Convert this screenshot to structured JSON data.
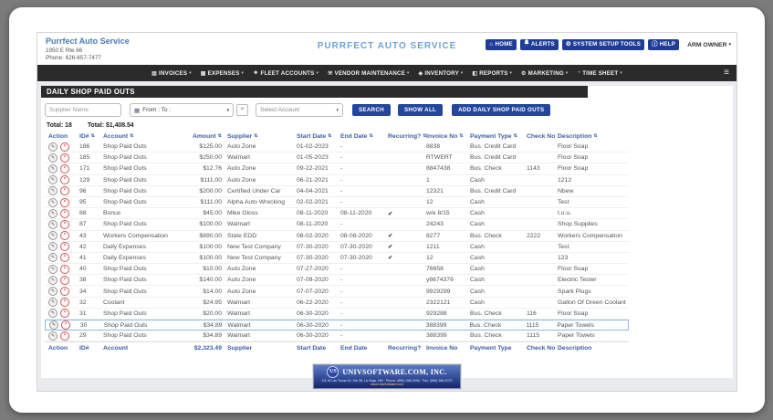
{
  "glyphs": {
    "caret_down": "▾",
    "sort": "⇅",
    "check": "✔",
    "pencil": "✎",
    "close": "×",
    "home": "⌂",
    "gear": "⚙",
    "info": "ⓘ",
    "bell": "🔔",
    "hamburger": "≡",
    "calendar": "▦"
  },
  "colors": {
    "accent_blue": "#24459c",
    "dark_bar": "#2b2b2b",
    "link_blue": "#3b5fa0",
    "title_blue": "#6fa3d9",
    "selected_row_border": "#93b9dd",
    "delete_red": "#c03030"
  },
  "topbar": {
    "company_name": "Purrfect Auto Service",
    "address": "1950 E Rte 66",
    "phone": "Phone: 626-857-7477",
    "app_title": "PURRFECT AUTO SERVICE",
    "buttons": [
      {
        "label": "HOME",
        "icon": "home-icon",
        "glyph": "⌂"
      },
      {
        "label": "ALERTS",
        "icon": "bell-icon",
        "glyph": "♪"
      },
      {
        "label": "SYSTEM SETUP TOOLS",
        "icon": "gear-icon",
        "glyph": "⚙"
      },
      {
        "label": "HELP",
        "icon": "info-icon",
        "glyph": "ⓘ"
      }
    ],
    "user_menu": "ARM OWNER"
  },
  "nav": {
    "items": [
      {
        "label": "INVOICES",
        "icon": "invoices-icon",
        "glyph": "▤"
      },
      {
        "label": "EXPENSES",
        "icon": "expenses-icon",
        "glyph": "▦"
      },
      {
        "label": "FLEET ACCOUNTS",
        "icon": "fleet-accounts-icon",
        "glyph": "☻"
      },
      {
        "label": "VENDOR MAINTENANCE",
        "icon": "vendor-maintenance-icon",
        "glyph": "⚒"
      },
      {
        "label": "INVENTORY",
        "icon": "inventory-icon",
        "glyph": "◆"
      },
      {
        "label": "REPORTS",
        "icon": "reports-icon",
        "glyph": "◧"
      },
      {
        "label": "MARKETING",
        "icon": "marketing-icon",
        "glyph": "⚙"
      },
      {
        "label": "TIME SHEET",
        "icon": "time-sheet-icon",
        "glyph": "◔"
      }
    ]
  },
  "panel": {
    "title": "DAILY SHOP PAID OUTS",
    "filters": {
      "supplier_placeholder": "Supplier Name",
      "date_range_label": "From : To :",
      "clear_label": "×",
      "account_select_value": "Select Account",
      "search_label": "SEARCH",
      "show_all_label": "SHOW ALL",
      "add_label": "ADD DAILY SHOP PAID OUTS"
    },
    "totals": {
      "count_label": "Total: 18",
      "amount_label": "Total: $1,408.54"
    },
    "table": {
      "headers": [
        "Action",
        "ID#",
        "Account",
        "Amount",
        "Supplier",
        "Start Date",
        "End Date",
        "Recurring?",
        "Invoice No",
        "Payment Type",
        "Check No",
        "Description"
      ],
      "rows": [
        {
          "id": "186",
          "account": "Shop Paid Outs",
          "amount": "$125.00",
          "supplier": "Auto Zone",
          "start_date": "01-02-2023",
          "end_date": "-",
          "recurring": false,
          "invoice_no": "8838",
          "payment_type": "Bus. Credit Card",
          "check_no": "",
          "description": "Floor Soap",
          "selected": false
        },
        {
          "id": "185",
          "account": "Shop Paid Outs",
          "amount": "$250.00",
          "supplier": "Walmart",
          "start_date": "01-05-2023",
          "end_date": "-",
          "recurring": false,
          "invoice_no": "RTWERT",
          "payment_type": "Bus. Credit Card",
          "check_no": "",
          "description": "Floor Soap",
          "selected": false
        },
        {
          "id": "171",
          "account": "Shop Paid Outs",
          "amount": "$12.76",
          "supplier": "Auto Zone",
          "start_date": "09-22-2021",
          "end_date": "-",
          "recurring": false,
          "invoice_no": "8847438",
          "payment_type": "Bus. Check",
          "check_no": "1143",
          "description": "Floor Soap",
          "selected": false
        },
        {
          "id": "129",
          "account": "Shop Paid Outs",
          "amount": "$111.00",
          "supplier": "Auto Zone",
          "start_date": "06-21-2021",
          "end_date": "-",
          "recurring": false,
          "invoice_no": "1",
          "payment_type": "Cash",
          "check_no": "",
          "description": "1212",
          "selected": false
        },
        {
          "id": "96",
          "account": "Shop Paid Outs",
          "amount": "$200.00",
          "supplier": "Certified Under Car",
          "start_date": "04-04-2021",
          "end_date": "-",
          "recurring": false,
          "invoice_no": "12321",
          "payment_type": "Bus. Credit Card",
          "check_no": "",
          "description": "Nbew",
          "selected": false
        },
        {
          "id": "95",
          "account": "Shop Paid Outs",
          "amount": "$111.00",
          "supplier": "Alpha Auto Wrecking",
          "start_date": "02-02-2021",
          "end_date": "-",
          "recurring": false,
          "invoice_no": "12",
          "payment_type": "Cash",
          "check_no": "",
          "description": "Test",
          "selected": false
        },
        {
          "id": "88",
          "account": "Bonus",
          "amount": "$45.00",
          "supplier": "Mike Gloss",
          "start_date": "08-11-2020",
          "end_date": "08-11-2020",
          "recurring": true,
          "invoice_no": "w/e 8/15",
          "payment_type": "Cash",
          "check_no": "",
          "description": "I.o.u.",
          "selected": false
        },
        {
          "id": "87",
          "account": "Shop Paid Outs",
          "amount": "$100.00",
          "supplier": "Walmart",
          "start_date": "08-11-2020",
          "end_date": "-",
          "recurring": false,
          "invoice_no": "24243",
          "payment_type": "Cash",
          "check_no": "",
          "description": "Shop Supplies",
          "selected": false
        },
        {
          "id": "43",
          "account": "Workers Compensation",
          "amount": "$890.00",
          "supplier": "State EDD",
          "start_date": "08-02-2020",
          "end_date": "08-08-2020",
          "recurring": true,
          "invoice_no": "8277",
          "payment_type": "Bus. Check",
          "check_no": "2222",
          "description": "Workers Compensation",
          "selected": false
        },
        {
          "id": "42",
          "account": "Daily Expenses",
          "amount": "$100.00",
          "supplier": "New Test Company",
          "start_date": "07-30-2020",
          "end_date": "07-30-2020",
          "recurring": true,
          "invoice_no": "1211",
          "payment_type": "Cash",
          "check_no": "",
          "description": "Test",
          "selected": false
        },
        {
          "id": "41",
          "account": "Daily Expenses",
          "amount": "$100.00",
          "supplier": "New Test Company",
          "start_date": "07-30-2020",
          "end_date": "07-30-2020",
          "recurring": true,
          "invoice_no": "12",
          "payment_type": "Cash",
          "check_no": "",
          "description": "123",
          "selected": false
        },
        {
          "id": "40",
          "account": "Shop Paid Outs",
          "amount": "$10.00",
          "supplier": "Auto Zone",
          "start_date": "07-27-2020",
          "end_date": "-",
          "recurring": false,
          "invoice_no": "76658",
          "payment_type": "Cash",
          "check_no": "",
          "description": "Floor Soap",
          "selected": false
        },
        {
          "id": "38",
          "account": "Shop Paid Outs",
          "amount": "$140.00",
          "supplier": "Auto Zone",
          "start_date": "07-09-2020",
          "end_date": "-",
          "recurring": false,
          "invoice_no": "y6674376",
          "payment_type": "Cash",
          "check_no": "",
          "description": "Electric Tester",
          "selected": false
        },
        {
          "id": "34",
          "account": "Shop Paid Outs",
          "amount": "$14.00",
          "supplier": "Auto Zone",
          "start_date": "07-07-2020",
          "end_date": "-",
          "recurring": false,
          "invoice_no": "9929299",
          "payment_type": "Cash",
          "check_no": "",
          "description": "Spark Plugs",
          "selected": false
        },
        {
          "id": "32",
          "account": "Coolant",
          "amount": "$24.95",
          "supplier": "Walmart",
          "start_date": "06-22-2020",
          "end_date": "-",
          "recurring": false,
          "invoice_no": "2322121",
          "payment_type": "Cash",
          "check_no": "",
          "description": "Gallon Of Green Coolant",
          "selected": false
        },
        {
          "id": "31",
          "account": "Shop Paid Outs",
          "amount": "$20.00",
          "supplier": "Walmart",
          "start_date": "06-30-2020",
          "end_date": "-",
          "recurring": false,
          "invoice_no": "929288",
          "payment_type": "Bus. Check",
          "check_no": "116",
          "description": "Floor Soap",
          "selected": false
        },
        {
          "id": "30",
          "account": "Shop Paid Outs",
          "amount": "$34.89",
          "supplier": "Walmart",
          "start_date": "06-30-2020",
          "end_date": "-",
          "recurring": false,
          "invoice_no": "388399",
          "payment_type": "Bus. Check",
          "check_no": "1115",
          "description": "Paper Towels",
          "selected": true
        },
        {
          "id": "29",
          "account": "Shop Paid Outs",
          "amount": "$34.89",
          "supplier": "Walmart",
          "start_date": "06-30-2020",
          "end_date": "-",
          "recurring": false,
          "invoice_no": "388399",
          "payment_type": "Bus. Check",
          "check_no": "1115",
          "description": "Paper Towels",
          "selected": false
        }
      ],
      "footer": [
        "Action",
        "ID#",
        "Account",
        "$2,323.49",
        "Supplier",
        "Start Date",
        "End Date",
        "Recurring?",
        "Invoice No",
        "Payment Type",
        "Check No",
        "Description"
      ]
    },
    "logo": {
      "monogram": "US",
      "title": "UNIVSOFTWARE.COM, INC.",
      "address_line": "111 W Las Tunas Dr, Ste 38, La Vega, NM · Phone: (866) 388-3098 · Fax: (866) 388-3073",
      "url_line": "www.UnivSoftware.com"
    }
  }
}
